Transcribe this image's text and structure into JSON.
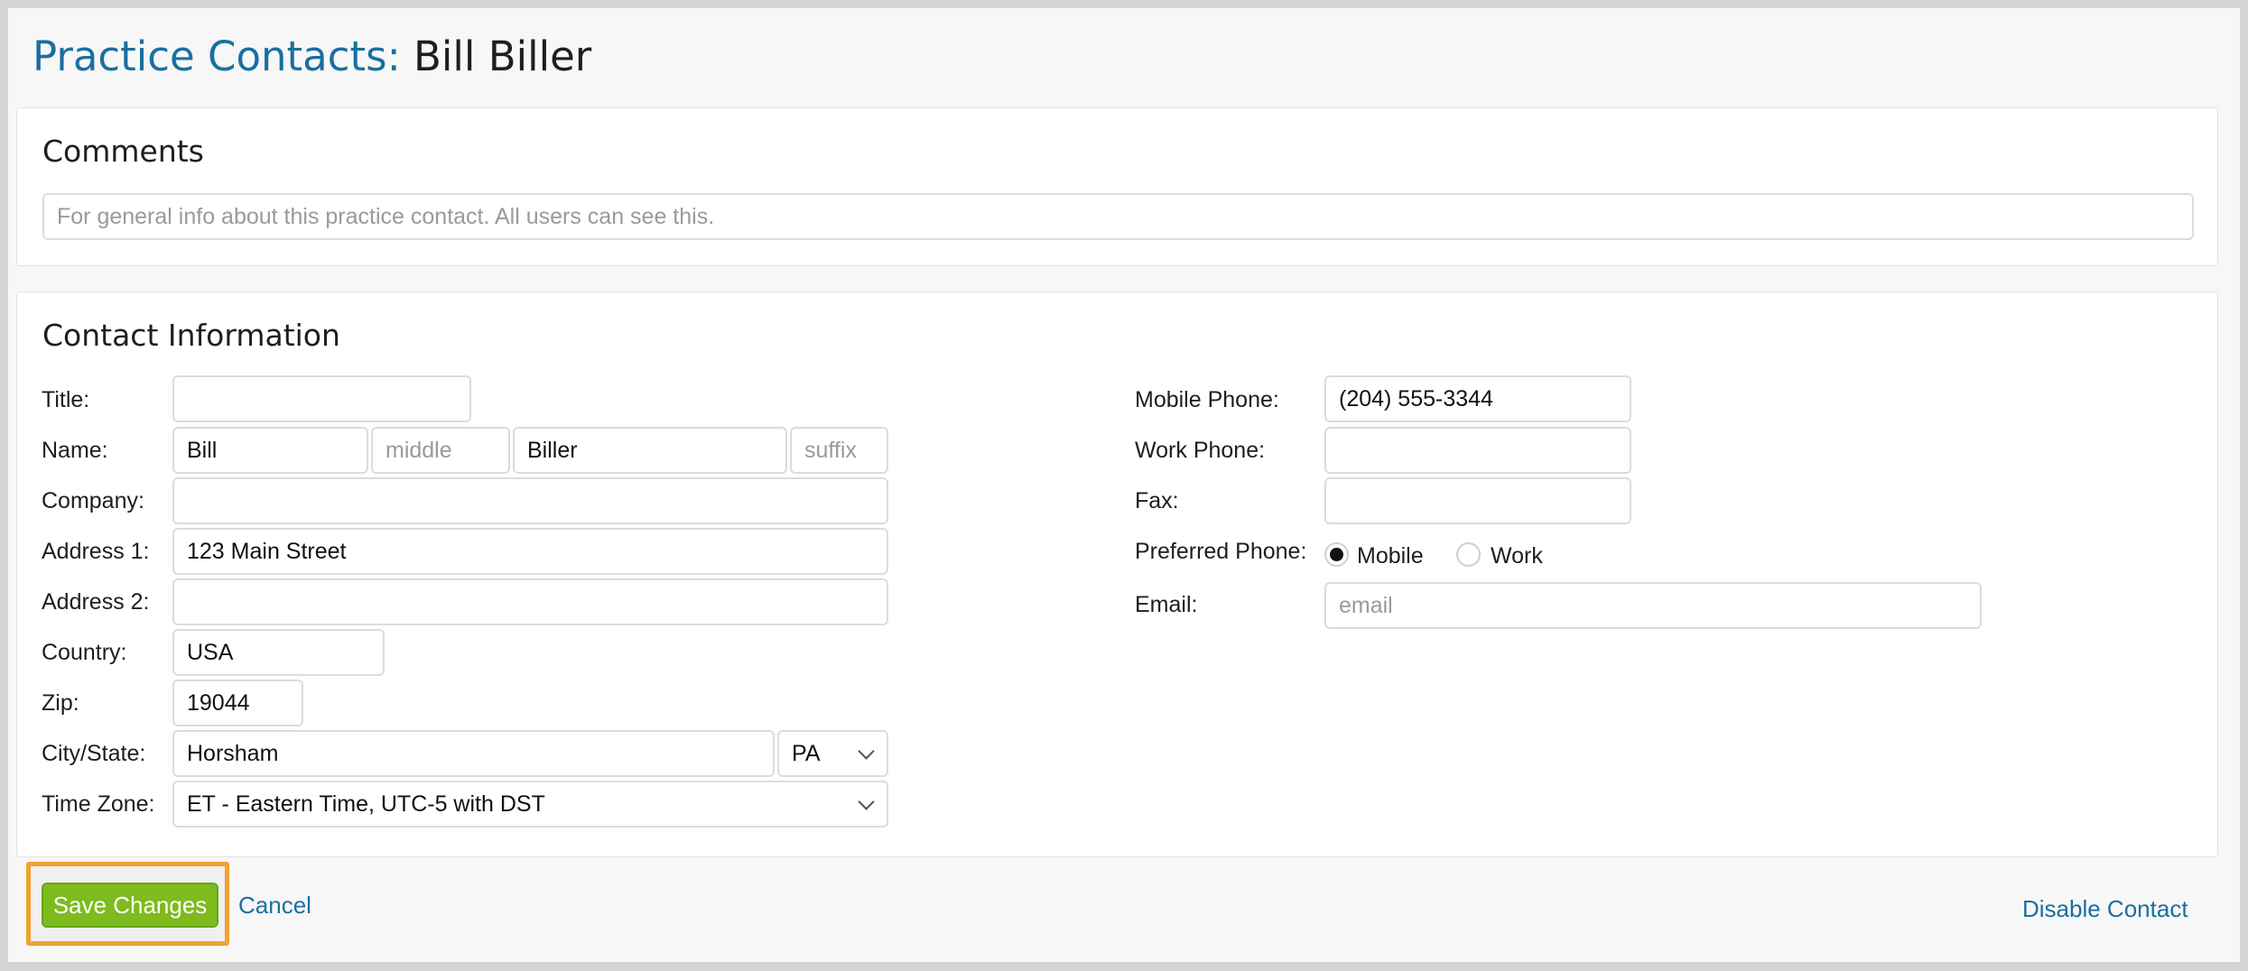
{
  "header": {
    "crumb": "Practice Contacts:",
    "contact_name": "Bill Biller"
  },
  "comments": {
    "heading": "Comments",
    "placeholder": "For general info about this practice contact. All users can see this."
  },
  "contact_info": {
    "heading": "Contact Information",
    "labels": {
      "title": "Title:",
      "name": "Name:",
      "company": "Company:",
      "address1": "Address 1:",
      "address2": "Address 2:",
      "country": "Country:",
      "zip": "Zip:",
      "city_state": "City/State:",
      "time_zone": "Time Zone:",
      "mobile_phone": "Mobile Phone:",
      "work_phone": "Work Phone:",
      "fax": "Fax:",
      "preferred_phone": "Preferred Phone:",
      "email": "Email:"
    },
    "values": {
      "title": "",
      "first_name": "Bill",
      "middle_placeholder": "middle",
      "last_name": "Biller",
      "suffix_placeholder": "suffix",
      "company": "",
      "address1": "123 Main Street",
      "address2": "",
      "country": "USA",
      "zip": "19044",
      "city": "Horsham",
      "state": "PA",
      "time_zone": "ET - Eastern Time, UTC-5 with DST",
      "mobile_phone": "(204) 555-3344",
      "work_phone": "",
      "fax": "",
      "email_placeholder": "email"
    },
    "preferred_phone_options": [
      {
        "label": "Mobile",
        "checked": true
      },
      {
        "label": "Work",
        "checked": false
      }
    ]
  },
  "actions": {
    "save": "Save Changes",
    "cancel": "Cancel",
    "disable": "Disable Contact"
  },
  "colors": {
    "link": "#1a6fa0",
    "save_button": "#7dbb1e",
    "highlight": "#f5a030"
  }
}
